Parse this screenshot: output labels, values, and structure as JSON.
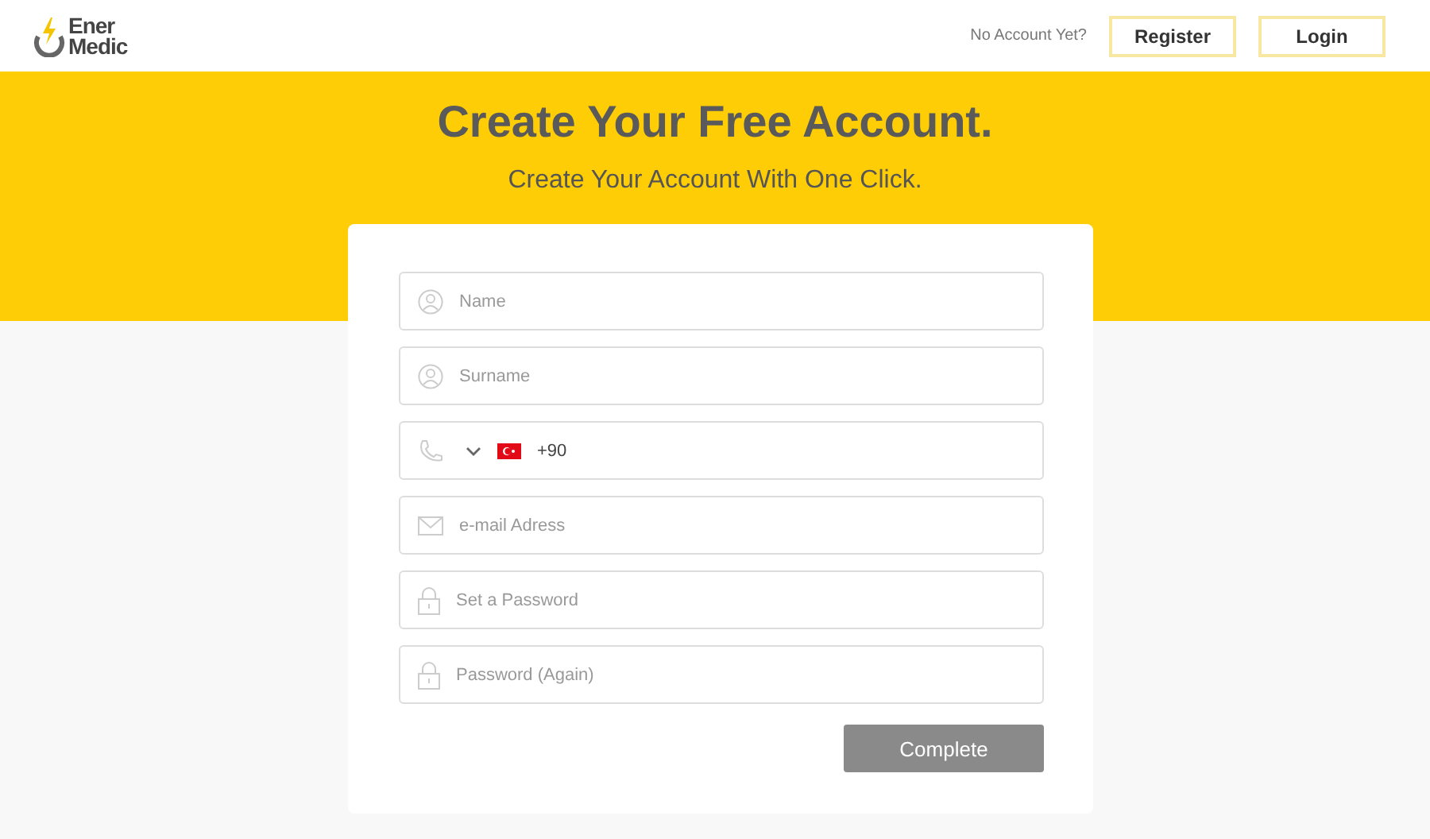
{
  "header": {
    "logo": {
      "line_1": "Ener",
      "line_2": "Medic"
    },
    "prompt": "No Account Yet?",
    "buttons": [
      "Register",
      "Login"
    ]
  },
  "hero": {
    "title": "Create Your Free Account.",
    "subtitle": "Create Your Account With One Click."
  },
  "form": {
    "fields": [
      {
        "kind": "person",
        "placeholder": "Name"
      },
      {
        "kind": "person",
        "placeholder": "Surname"
      },
      {
        "kind": "phone",
        "value": "+90"
      },
      {
        "kind": "mail",
        "placeholder": "e-mail Adress"
      },
      {
        "kind": "lock",
        "placeholder": "Set a Password"
      },
      {
        "kind": "lock",
        "placeholder": "Password (Again)"
      }
    ],
    "submit": "Complete"
  }
}
